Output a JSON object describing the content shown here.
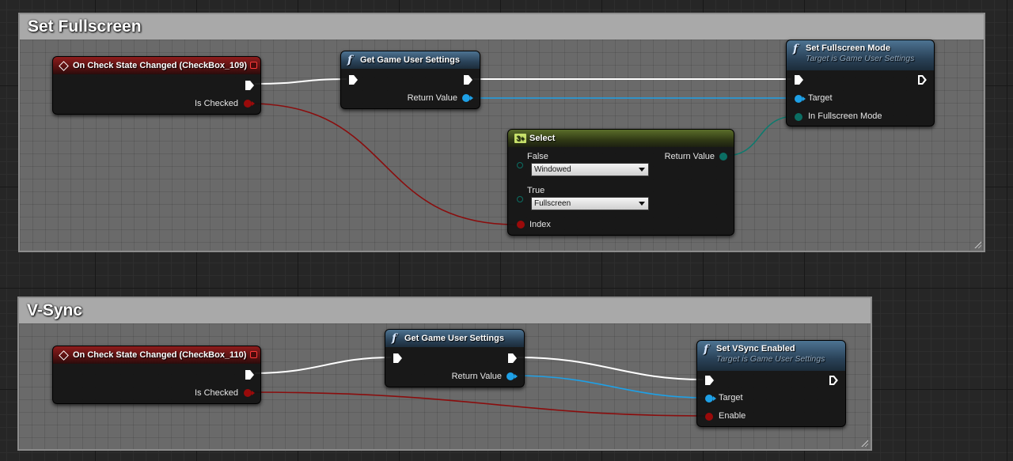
{
  "comments": {
    "fullscreen": {
      "title": "Set Fullscreen"
    },
    "vsync": {
      "title": "V-Sync"
    }
  },
  "fullscreen_group": {
    "event": {
      "title": "On Check State Changed (CheckBox_109)",
      "pin_is_checked": "Is Checked"
    },
    "get_settings": {
      "title": "Get Game User Settings",
      "pin_return": "Return Value"
    },
    "set_mode": {
      "title": "Set Fullscreen Mode",
      "subtitle": "Target is Game User Settings",
      "pin_target": "Target",
      "pin_mode": "In Fullscreen Mode"
    },
    "select": {
      "title": "Select",
      "pin_false": "False",
      "false_value": "Windowed",
      "pin_true": "True",
      "true_value": "Fullscreen",
      "pin_index": "Index",
      "pin_return": "Return Value"
    }
  },
  "vsync_group": {
    "event": {
      "title": "On Check State Changed (CheckBox_110)",
      "pin_is_checked": "Is Checked"
    },
    "get_settings": {
      "title": "Get Game User Settings",
      "pin_return": "Return Value"
    },
    "set_vsync": {
      "title": "Set VSync Enabled",
      "subtitle": "Target is Game User Settings",
      "pin_target": "Target",
      "pin_enable": "Enable"
    }
  },
  "colors": {
    "exec_wire": "#ffffff",
    "object_wire": "#1ea0e6",
    "bool_wire": "#8a0d0d",
    "enum_wire": "#0e7a6e",
    "event_header": "#8e1c1c",
    "function_header": "#4d7392",
    "select_header": "#5a6d2a"
  },
  "icons": {
    "event": "event-diamond-icon",
    "function": "function-f-icon",
    "select": "select-icon",
    "delegate": "delegate-square-icon"
  }
}
